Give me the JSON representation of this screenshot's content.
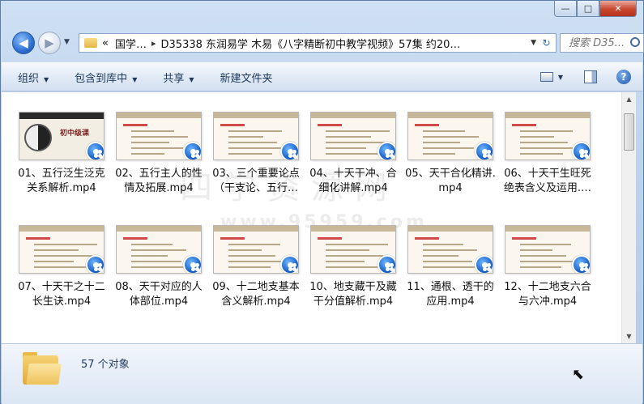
{
  "window": {
    "caption": {
      "minimize": "—",
      "maximize": "□",
      "close": "✕"
    }
  },
  "nav": {
    "back_icon": "◀",
    "forward_icon": "▶",
    "history_icon": "▼",
    "breadcrumb": [
      "国学…",
      "D35338 东润易学 木易《八字精断初中教学视频》57集 约20…"
    ],
    "breadcrumb_prefix": "«",
    "breadcrumb_sep": "▸",
    "address_dropdown": "▼",
    "refresh_icon": "↻",
    "search_placeholder": "搜索 D35..."
  },
  "toolbar": {
    "organize": "组织",
    "include_library": "包含到库中",
    "share": "共享",
    "new_folder": "新建文件夹",
    "dropdown_arrow": "▼",
    "help": "?"
  },
  "files": [
    {
      "name": "01、五行泛生泛克关系解析.mp4",
      "cover": true,
      "cover_title": "初中级课"
    },
    {
      "name": "02、五行主人的性情及拓展.mp4"
    },
    {
      "name": "03、三个重要论点（干支论、五行…"
    },
    {
      "name": "04、十天干冲、合细化讲解.mp4"
    },
    {
      "name": "05、天干合化精讲.mp4"
    },
    {
      "name": "06、十天干生旺死绝表含义及运用.…"
    },
    {
      "name": "07、十天干之十二长生诀.mp4"
    },
    {
      "name": "08、天干对应的人体部位.mp4"
    },
    {
      "name": "09、十二地支基本含义解析.mp4"
    },
    {
      "name": "10、地支藏干及藏干分值解析.mp4"
    },
    {
      "name": "11、通根、透干的应用.mp4"
    },
    {
      "name": "12、十二地支六合与六冲.mp4"
    }
  ],
  "watermark": {
    "line1": "四学资源网",
    "line2": "www.95959.com"
  },
  "scrollbar": {
    "up": "▲",
    "down": "▼"
  },
  "status": {
    "count": "57 个对象"
  },
  "colors": {
    "accent": "#1d55a8",
    "close": "#c9462e",
    "watermark": "#ececec"
  }
}
